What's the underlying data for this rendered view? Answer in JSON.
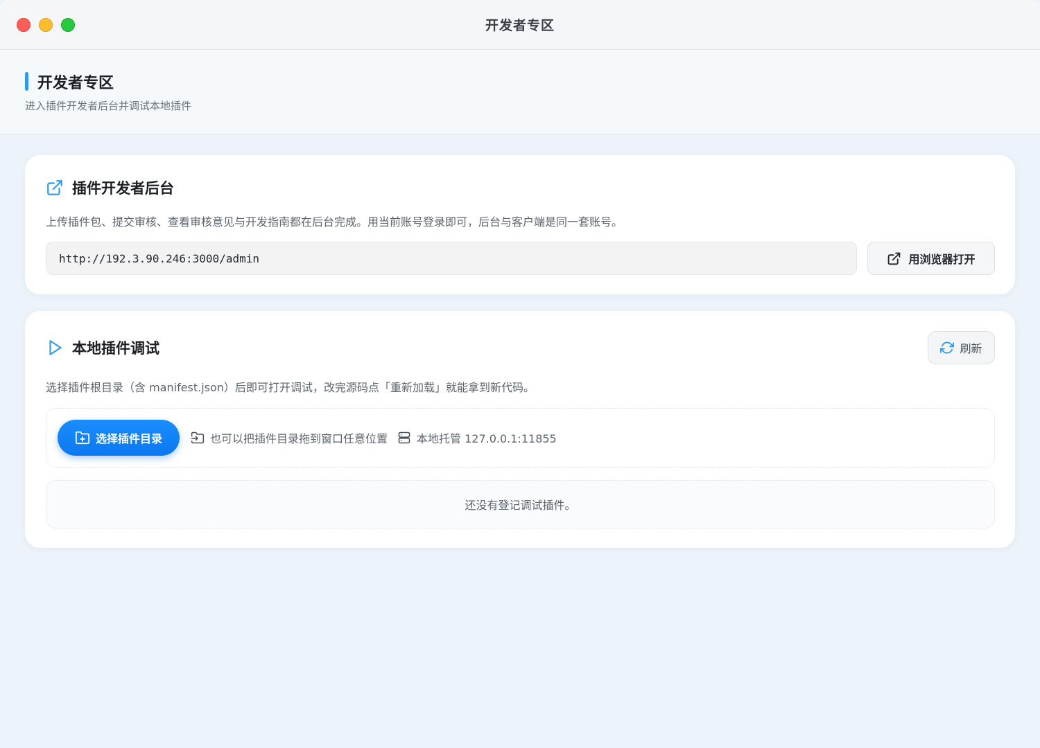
{
  "window": {
    "title": "开发者专区",
    "controls": [
      "close",
      "minimize",
      "maximize"
    ]
  },
  "header": {
    "title": "开发者专区",
    "subtitle": "进入插件开发者后台并调试本地插件"
  },
  "admin_card": {
    "icon": "external-link-icon",
    "title": "插件开发者后台",
    "description": "上传插件包、提交审核、查看审核意见与开发指南都在后台完成。用当前账号登录即可，后台与客户端是同一套账号。",
    "url": "http://192.3.90.246:3000/admin",
    "open_button_label": "用浏览器打开"
  },
  "debug_card": {
    "icon": "play-icon",
    "title": "本地插件调试",
    "refresh_label": "刷新",
    "description": "选择插件根目录（含 manifest.json）后即可打开调试，改完源码点「重新加载」就能拿到新代码。",
    "select_button_label": "选择插件目录",
    "drag_hint": "也可以把插件目录拖到窗口任意位置",
    "host_hint": "本地托管 127.0.0.1:11855",
    "empty_text": "还没有登记调试插件。"
  },
  "colors": {
    "accent": "#2f9ae8",
    "primary_button": "#0b78f0",
    "background": "#edf3fa"
  }
}
